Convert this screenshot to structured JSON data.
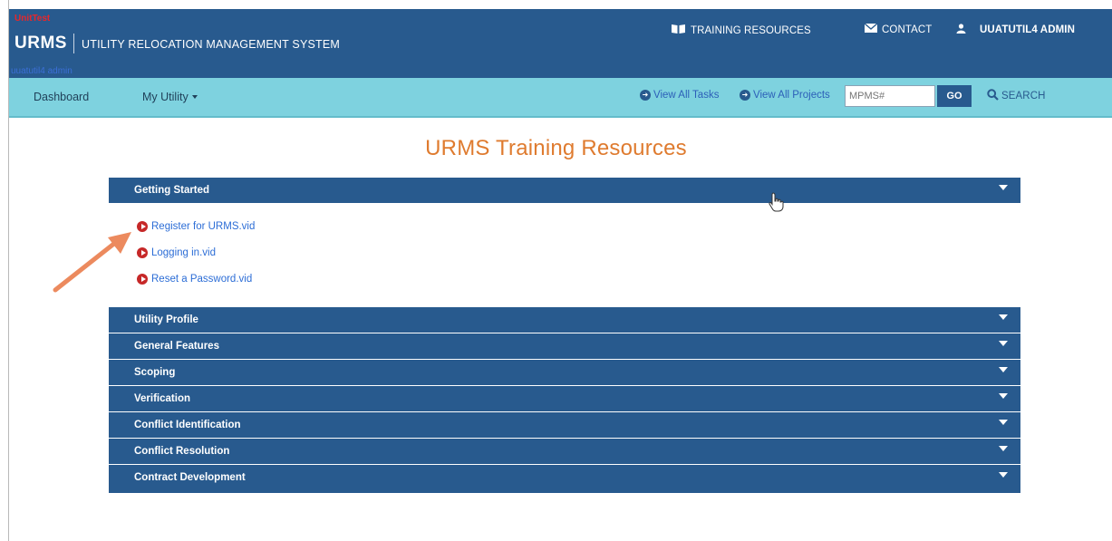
{
  "header": {
    "env_label": "UnitTest",
    "brand": "URMS",
    "brand_full": "UTILITY RELOCATION MANAGEMENT SYSTEM",
    "user_role": "uuatutil4 admin",
    "training_resources": "TRAINING RESOURCES",
    "contact": "CONTACT",
    "user_name": "UUATUTIL4 ADMIN"
  },
  "nav": {
    "dashboard": "Dashboard",
    "my_utility": "My Utility",
    "view_all_tasks": "View All Tasks",
    "view_all_projects": "View All Projects",
    "mpms_placeholder": "MPMS#",
    "go": "GO",
    "search": "SEARCH"
  },
  "page": {
    "title": "URMS Training Resources"
  },
  "sections": [
    {
      "label": "Getting Started",
      "expanded": true
    },
    {
      "label": "Utility Profile"
    },
    {
      "label": "General Features"
    },
    {
      "label": "Scoping"
    },
    {
      "label": "Verification"
    },
    {
      "label": "Conflict Identification"
    },
    {
      "label": "Conflict Resolution"
    },
    {
      "label": "Contract Development"
    }
  ],
  "getting_started_videos": [
    {
      "label": "Register for URMS.vid"
    },
    {
      "label": "Logging in.vid"
    },
    {
      "label": "Reset a Password.vid"
    }
  ],
  "colors": {
    "header_bg": "#285a8e",
    "nav_bg": "#7ed2df",
    "title": "#df7b2f",
    "link": "#2c6dd6",
    "play": "#c62828",
    "annotation_arrow": "#ec8a5e"
  },
  "icons": {
    "training": "book-icon",
    "contact": "envelope-icon",
    "user": "user-icon",
    "search": "search-icon",
    "video": "play-icon"
  }
}
